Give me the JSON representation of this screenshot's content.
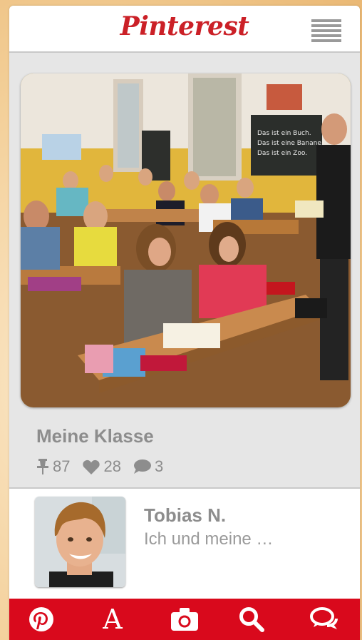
{
  "app": {
    "logo_text": "Pinterest"
  },
  "header": {
    "menu_icon": "hamburger-menu-icon"
  },
  "pin": {
    "title": "Meine Klasse",
    "image": "classroom-photo",
    "stats": {
      "repins": "87",
      "likes": "28",
      "comments": "3"
    }
  },
  "user": {
    "name": "Tobias N.",
    "description": "Ich und meine …",
    "avatar": "boy-portrait-photo"
  },
  "tabbar": {
    "items": [
      {
        "icon": "pinterest-logo-icon"
      },
      {
        "icon": "text-a-icon"
      },
      {
        "icon": "camera-icon"
      },
      {
        "icon": "search-icon"
      },
      {
        "icon": "chat-bubbles-icon"
      }
    ]
  },
  "colors": {
    "brand_red": "#cb2027",
    "tabbar_red": "#d9091c",
    "text_gray": "#8d8d8d"
  }
}
